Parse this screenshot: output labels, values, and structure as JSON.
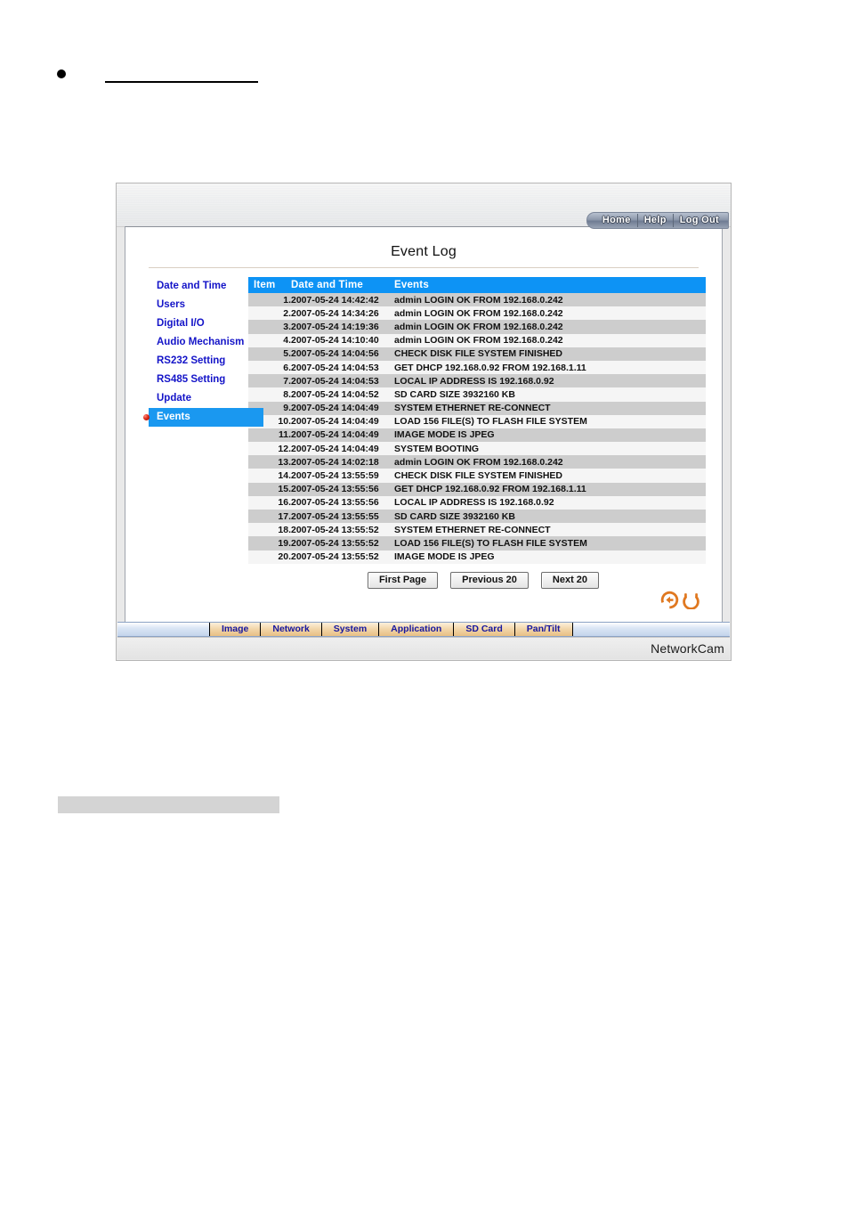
{
  "document": {
    "bullet_marker": "bullet-icon",
    "heading_rule": "blank-underline",
    "gray_block": "redacted-block"
  },
  "top_nav": {
    "items": [
      {
        "label": "Home"
      },
      {
        "label": "Help"
      },
      {
        "label": "Log Out"
      }
    ]
  },
  "page": {
    "title": "Event Log"
  },
  "sidebar": {
    "items": [
      {
        "label": "Date and Time",
        "active": false
      },
      {
        "label": "Users",
        "active": false
      },
      {
        "label": "Digital I/O",
        "active": false
      },
      {
        "label": "Audio Mechanism",
        "active": false
      },
      {
        "label": "RS232 Setting",
        "active": false
      },
      {
        "label": "RS485 Setting",
        "active": false
      },
      {
        "label": "Update",
        "active": false
      },
      {
        "label": "Events",
        "active": true
      }
    ]
  },
  "event_table": {
    "columns": [
      "Item",
      "Date and Time",
      "Events"
    ],
    "rows": [
      {
        "item": "1.",
        "datetime": "2007-05-24 14:42:42",
        "event": "admin LOGIN OK FROM 192.168.0.242"
      },
      {
        "item": "2.",
        "datetime": "2007-05-24 14:34:26",
        "event": "admin LOGIN OK FROM 192.168.0.242"
      },
      {
        "item": "3.",
        "datetime": "2007-05-24 14:19:36",
        "event": "admin LOGIN OK FROM 192.168.0.242"
      },
      {
        "item": "4.",
        "datetime": "2007-05-24 14:10:40",
        "event": "admin LOGIN OK FROM 192.168.0.242"
      },
      {
        "item": "5.",
        "datetime": "2007-05-24 14:04:56",
        "event": "CHECK DISK FILE SYSTEM FINISHED"
      },
      {
        "item": "6.",
        "datetime": "2007-05-24 14:04:53",
        "event": "GET DHCP 192.168.0.92 FROM 192.168.1.11"
      },
      {
        "item": "7.",
        "datetime": "2007-05-24 14:04:53",
        "event": "LOCAL IP ADDRESS IS 192.168.0.92"
      },
      {
        "item": "8.",
        "datetime": "2007-05-24 14:04:52",
        "event": "SD CARD SIZE 3932160 KB"
      },
      {
        "item": "9.",
        "datetime": "2007-05-24 14:04:49",
        "event": "SYSTEM ETHERNET RE-CONNECT"
      },
      {
        "item": "10.",
        "datetime": "2007-05-24 14:04:49",
        "event": "LOAD 156 FILE(S) TO FLASH FILE SYSTEM"
      },
      {
        "item": "11.",
        "datetime": "2007-05-24 14:04:49",
        "event": "IMAGE MODE IS JPEG"
      },
      {
        "item": "12.",
        "datetime": "2007-05-24 14:04:49",
        "event": "SYSTEM BOOTING"
      },
      {
        "item": "13.",
        "datetime": "2007-05-24 14:02:18",
        "event": "admin LOGIN OK FROM 192.168.0.242"
      },
      {
        "item": "14.",
        "datetime": "2007-05-24 13:55:59",
        "event": "CHECK DISK FILE SYSTEM FINISHED"
      },
      {
        "item": "15.",
        "datetime": "2007-05-24 13:55:56",
        "event": "GET DHCP 192.168.0.92 FROM 192.168.1.11"
      },
      {
        "item": "16.",
        "datetime": "2007-05-24 13:55:56",
        "event": "LOCAL IP ADDRESS IS 192.168.0.92"
      },
      {
        "item": "17.",
        "datetime": "2007-05-24 13:55:55",
        "event": "SD CARD SIZE 3932160 KB"
      },
      {
        "item": "18.",
        "datetime": "2007-05-24 13:55:52",
        "event": "SYSTEM ETHERNET RE-CONNECT"
      },
      {
        "item": "19.",
        "datetime": "2007-05-24 13:55:52",
        "event": "LOAD 156 FILE(S) TO FLASH FILE SYSTEM"
      },
      {
        "item": "20.",
        "datetime": "2007-05-24 13:55:52",
        "event": "IMAGE MODE IS JPEG"
      }
    ]
  },
  "pagination": {
    "first_page": "First Page",
    "previous": "Previous 20",
    "next": "Next 20"
  },
  "nav_icons": {
    "back": "back-arrow-icon",
    "refresh": "refresh-icon",
    "color": "#E07820"
  },
  "bottom_tabs": {
    "items": [
      {
        "label": "Image"
      },
      {
        "label": "Network"
      },
      {
        "label": "System"
      },
      {
        "label": "Application"
      },
      {
        "label": "SD Card"
      },
      {
        "label": "Pan/Tilt"
      }
    ]
  },
  "footer": {
    "brand": "NetworkCam"
  },
  "colors": {
    "table_header_blue": "#0D93F5",
    "sidebar_link_blue": "#1414C8",
    "sidebar_active_blue": "#1A98F0",
    "tab_orange": "#F2D7AC",
    "tab_text_blue": "#17179E",
    "row_gray": "#CDCDCD",
    "row_light": "#F5F5F5"
  }
}
